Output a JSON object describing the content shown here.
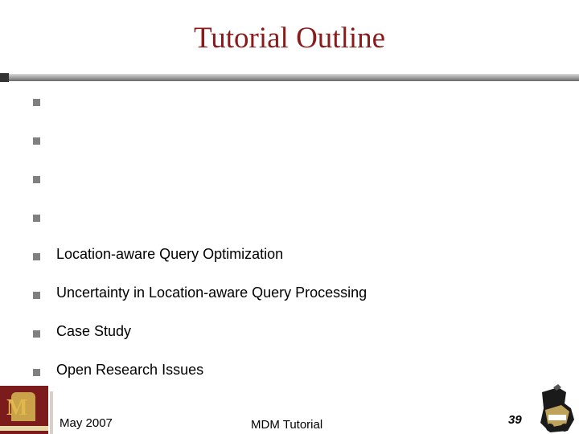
{
  "slide": {
    "title": "Tutorial Outline"
  },
  "bullets": [
    {
      "text": ""
    },
    {
      "text": ""
    },
    {
      "text": ""
    },
    {
      "text": ""
    },
    {
      "text": "Location-aware Query Optimization"
    },
    {
      "text": "Uncertainty in Location-aware Query Processing"
    },
    {
      "text": "Case Study"
    },
    {
      "text": "Open Research Issues"
    }
  ],
  "footer": {
    "date": "May 2007",
    "center": "MDM Tutorial",
    "page_number": "39"
  },
  "colors": {
    "title": "#8b1a1a",
    "bullet": "#808080",
    "rule": "#6a6a6a"
  },
  "icons": {
    "left_logo": "university-logo-icon",
    "right_logo": "purdue-train-logo-icon"
  }
}
